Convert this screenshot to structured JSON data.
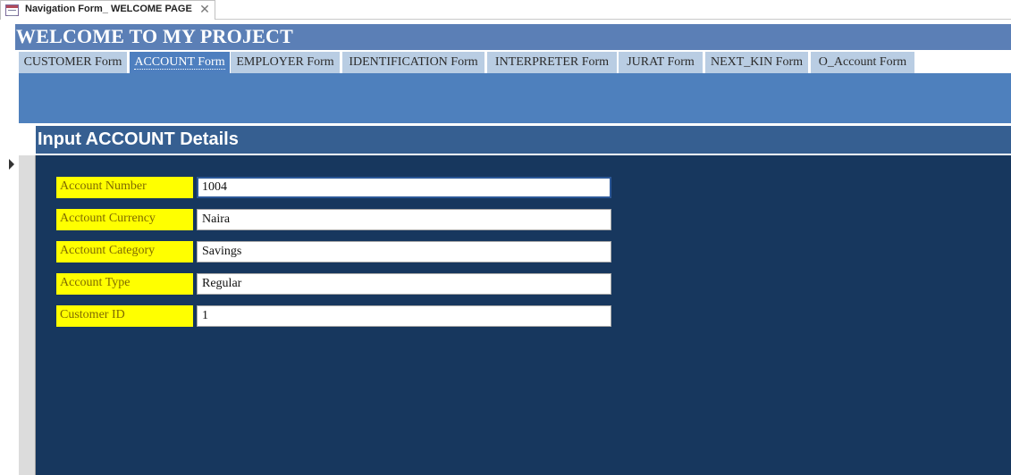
{
  "window": {
    "doc_tab_title": "Navigation Form_ WELCOME PAGE",
    "doc_tab_icon": "form-icon",
    "close_glyph": "✕"
  },
  "header": {
    "title": "WELCOME TO MY PROJECT"
  },
  "nav_tabs": [
    {
      "label": "CUSTOMER Form",
      "active": false
    },
    {
      "label": "ACCOUNT Form",
      "active": true
    },
    {
      "label": "EMPLOYER Form",
      "active": false
    },
    {
      "label": "IDENTIFICATION Form",
      "active": false
    },
    {
      "label": "INTERPRETER Form",
      "active": false
    },
    {
      "label": "JURAT Form",
      "active": false
    },
    {
      "label": "NEXT_KIN Form",
      "active": false
    },
    {
      "label": "O_Account Form",
      "active": false
    }
  ],
  "form": {
    "title": "Input ACCOUNT Details",
    "fields": [
      {
        "label": "Account Number",
        "value": "1004",
        "focused": true
      },
      {
        "label": "Acctount Currency",
        "value": "Naira",
        "focused": false
      },
      {
        "label": "Acctount Category",
        "value": "Savings",
        "focused": false
      },
      {
        "label": "Account Type",
        "value": "Regular",
        "focused": false
      },
      {
        "label": "Customer ID",
        "value": "1",
        "focused": false
      }
    ]
  },
  "colors": {
    "header_band": "#5b7fb6",
    "active_tab": "#4e7fbf",
    "inactive_tab": "#b9cde3",
    "form_header": "#365f91",
    "detail_background": "#17375e",
    "label_background": "#ffff00"
  }
}
